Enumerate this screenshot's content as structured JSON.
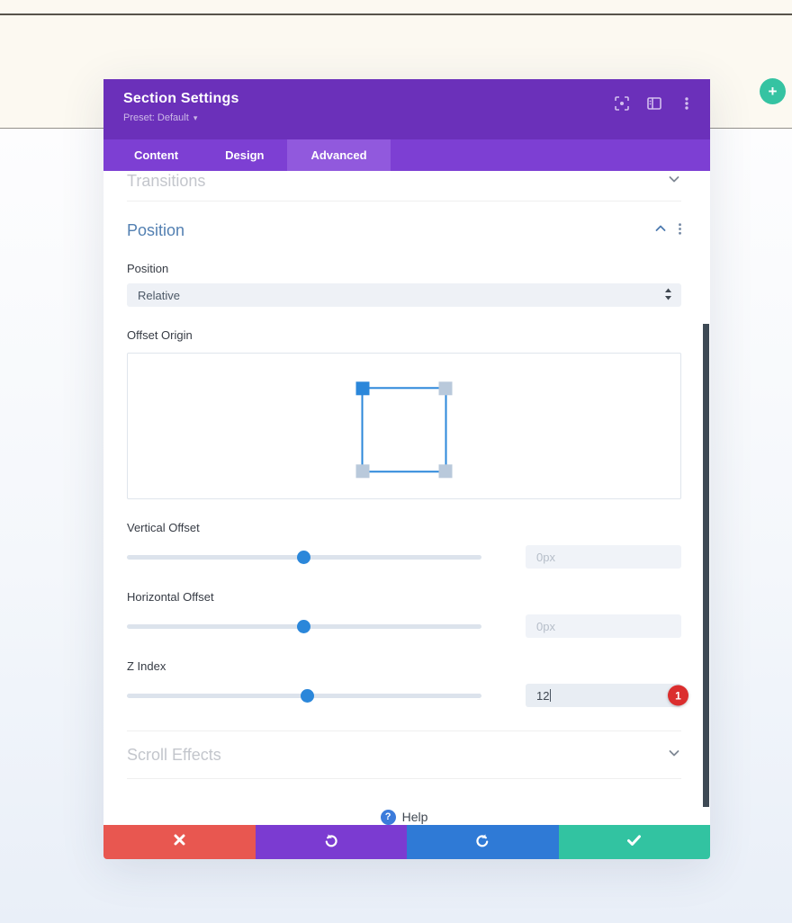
{
  "page": {
    "add_button_label": "+"
  },
  "modal": {
    "title": "Section Settings",
    "preset_label": "Preset: Default",
    "preset_caret": "▾",
    "header_icons": [
      "focus-icon",
      "dock-icon",
      "kebab-menu-icon"
    ],
    "tabs": [
      {
        "label": "Content",
        "active": false
      },
      {
        "label": "Design",
        "active": false
      },
      {
        "label": "Advanced",
        "active": true
      }
    ],
    "sections": {
      "transitions": {
        "title": "Transitions",
        "state": "collapsed"
      },
      "position": {
        "title": "Position",
        "state": "expanded",
        "fields": {
          "position": {
            "label": "Position",
            "value": "Relative"
          },
          "offset_origin": {
            "label": "Offset Origin",
            "selected_corner": "top-left"
          },
          "vertical_offset": {
            "label": "Vertical Offset",
            "placeholder": "0px",
            "slider_percent": 50
          },
          "horizontal_offset": {
            "label": "Horizontal Offset",
            "placeholder": "0px",
            "slider_percent": 50
          },
          "z_index": {
            "label": "Z Index",
            "value": "12",
            "slider_percent": 51,
            "badge": "1"
          }
        }
      },
      "scroll_effects": {
        "title": "Scroll Effects",
        "state": "collapsed"
      }
    },
    "help_label": "Help",
    "footer_buttons": [
      {
        "name": "discard",
        "icon": "x-icon"
      },
      {
        "name": "undo",
        "icon": "undo-icon"
      },
      {
        "name": "redo",
        "icon": "redo-icon"
      },
      {
        "name": "save",
        "icon": "check-icon"
      }
    ]
  },
  "colors": {
    "header_purple": "#6b30ba",
    "tabbar_purple": "#7d3fd3",
    "active_tab_purple": "#9159dd",
    "accent_blue": "#2b87da",
    "section_title_blue": "#5380b2",
    "badge_red": "#db2e2e",
    "discard_red": "#e85750",
    "undo_purple": "#7b3bd1",
    "redo_blue": "#2f7ad6",
    "save_green": "#32c3a1",
    "add_button_teal": "#35c3a2"
  }
}
